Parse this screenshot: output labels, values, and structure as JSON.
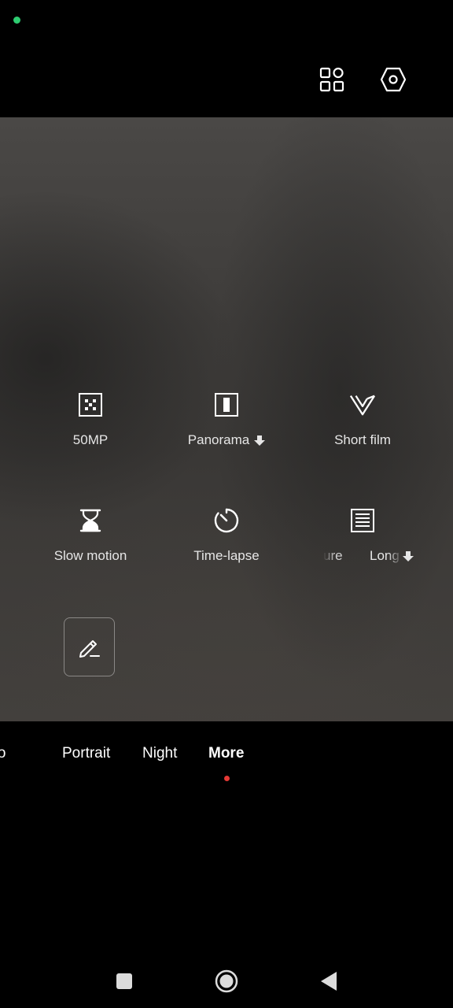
{
  "status": {
    "indicator_color": "#2ecc71"
  },
  "top_bar": {
    "icons": [
      "grid-icon",
      "settings-hexagon-icon"
    ]
  },
  "modes_panel": {
    "tiles": [
      {
        "label": "50MP",
        "icon": "50mp-icon",
        "downloadable": false
      },
      {
        "label": "Panorama",
        "icon": "panorama-icon",
        "downloadable": true
      },
      {
        "label": "Short film",
        "icon": "short-film-icon",
        "downloadable": false
      },
      {
        "label": "Slow motion",
        "icon": "hourglass-icon",
        "downloadable": false
      },
      {
        "label": "Time-lapse",
        "icon": "timer-icon",
        "downloadable": false
      },
      {
        "label_left_partial": "ure",
        "label_right_partial": "Long",
        "icon": "long-exposure-icon",
        "downloadable": true
      }
    ],
    "edit_button_icon": "edit-pencil-icon"
  },
  "mode_strip": {
    "items": [
      "oto",
      "Portrait",
      "Night",
      "More"
    ],
    "active": "More",
    "active_dot_color": "#e53935"
  },
  "nav_bar": {
    "icons": [
      "recents-square-icon",
      "home-circle-icon",
      "back-triangle-icon"
    ]
  }
}
